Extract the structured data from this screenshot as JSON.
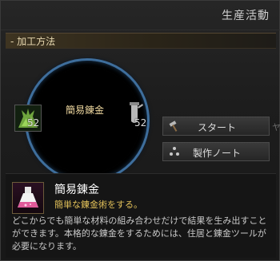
{
  "window": {
    "title": "生産活動"
  },
  "section": {
    "label": "- 加工方法"
  },
  "craft": {
    "name": "簡易錬金",
    "materials": [
      {
        "icon": "herb-icon",
        "count": "52"
      },
      {
        "icon": "flask-icon",
        "count": "52"
      }
    ]
  },
  "buttons": {
    "start_label": "スタート",
    "note_label": "製作ノート"
  },
  "side_hint": "ヤ",
  "info": {
    "name": "簡易錬金",
    "short_desc": "簡単な錬金術をする。",
    "long_desc": "どこからでも簡単な材料の組み合わせだけで結果を生み出すことができます。本格的な錬金をするためには、住居と錬金ツールが必要になります。"
  },
  "colors": {
    "ring": "#3e6e9c",
    "accent_gold": "#e4c25a",
    "header_bg": "#3e3421"
  }
}
